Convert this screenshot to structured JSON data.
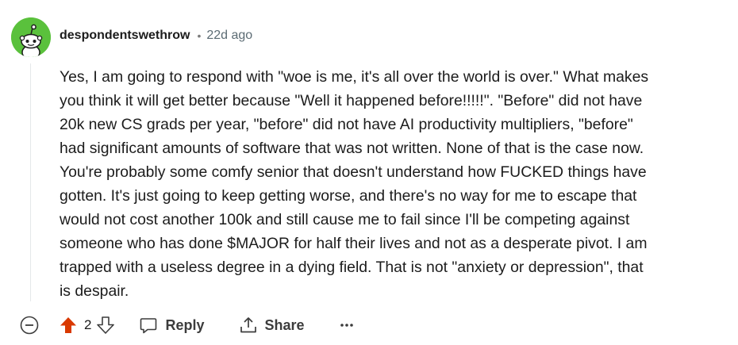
{
  "comment": {
    "username": "despondentswethrow",
    "separator": "•",
    "timestamp": "22d ago",
    "body_lines": [
      "Yes, I am going to respond with \"woe is me, it's all over the world is over.\" What makes",
      "you think it will get better because \"Well it happened before!!!!!\". \"Before\" did not have",
      "20k new CS grads per year, \"before\" did not have AI productivity multipliers, \"before\"",
      "had significant amounts of software that was not written. None of that is the case now.",
      "You're probably some comfy senior that doesn't understand how FUCKED things have",
      "gotten. It's just going to keep getting worse, and there's no way for me to escape that",
      "would not cost another 100k and still cause me to fail since I'll be competing against",
      "someone who has done $MAJOR for half their lives and not as a desperate pivot. I am",
      "trapped with a useless degree in a dying field. That is not \"anxiety or depression\", that",
      "is despair."
    ]
  },
  "actions": {
    "vote_count": "2",
    "reply_label": "Reply",
    "share_label": "Share",
    "more_label": "•••"
  },
  "icons": {
    "avatar": "snoo-avatar",
    "collapse": "minus-circle-icon",
    "upvote": "upvote-filled-icon",
    "downvote": "downvote-icon",
    "reply": "comment-bubble-icon",
    "share": "share-icon"
  },
  "colors": {
    "avatar_bg": "#5ac13c",
    "upvote_active": "#d93900",
    "text": "#1c1c1c",
    "meta": "#5c6c74"
  }
}
